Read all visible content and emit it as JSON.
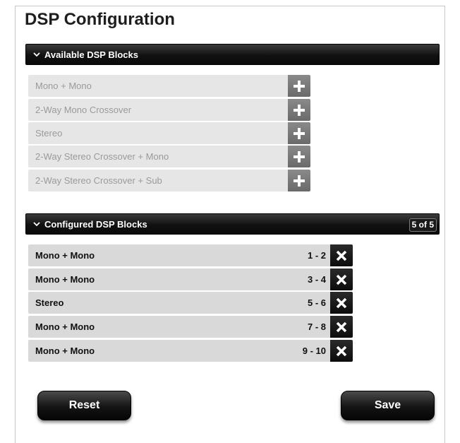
{
  "page": {
    "title": "DSP Configuration"
  },
  "available": {
    "header": "Available DSP Blocks",
    "toggle_icon": "chevron-down-icon",
    "items": [
      {
        "label": "Mono + Mono",
        "action_icon": "plus-icon"
      },
      {
        "label": "2-Way Mono Crossover",
        "action_icon": "plus-icon"
      },
      {
        "label": "Stereo",
        "action_icon": "plus-icon"
      },
      {
        "label": "2-Way Stereo Crossover + Mono",
        "action_icon": "plus-icon"
      },
      {
        "label": "2-Way Stereo Crossover + Sub",
        "action_icon": "plus-icon"
      }
    ]
  },
  "configured": {
    "header": "Configured DSP Blocks",
    "toggle_icon": "chevron-down-icon",
    "count": "5 of 5",
    "items": [
      {
        "label": "Mono + Mono",
        "channels": "1 - 2",
        "action_icon": "close-icon"
      },
      {
        "label": "Mono + Mono",
        "channels": "3 - 4",
        "action_icon": "close-icon"
      },
      {
        "label": "Stereo",
        "channels": "5 - 6",
        "action_icon": "close-icon"
      },
      {
        "label": "Mono + Mono",
        "channels": "7 - 8",
        "action_icon": "close-icon"
      },
      {
        "label": "Mono + Mono",
        "channels": "9 - 10",
        "action_icon": "close-icon"
      }
    ]
  },
  "actions": {
    "reset_label": "Reset",
    "save_label": "Save"
  },
  "colors": {
    "header_bg": "#111111",
    "available_row_bg": "#e6e6e6",
    "available_text": "#9a9a9a",
    "configured_row_bg": "#d9d9d9",
    "plus_button_bg": "#7a7a7a",
    "remove_button_bg": "#111111"
  }
}
